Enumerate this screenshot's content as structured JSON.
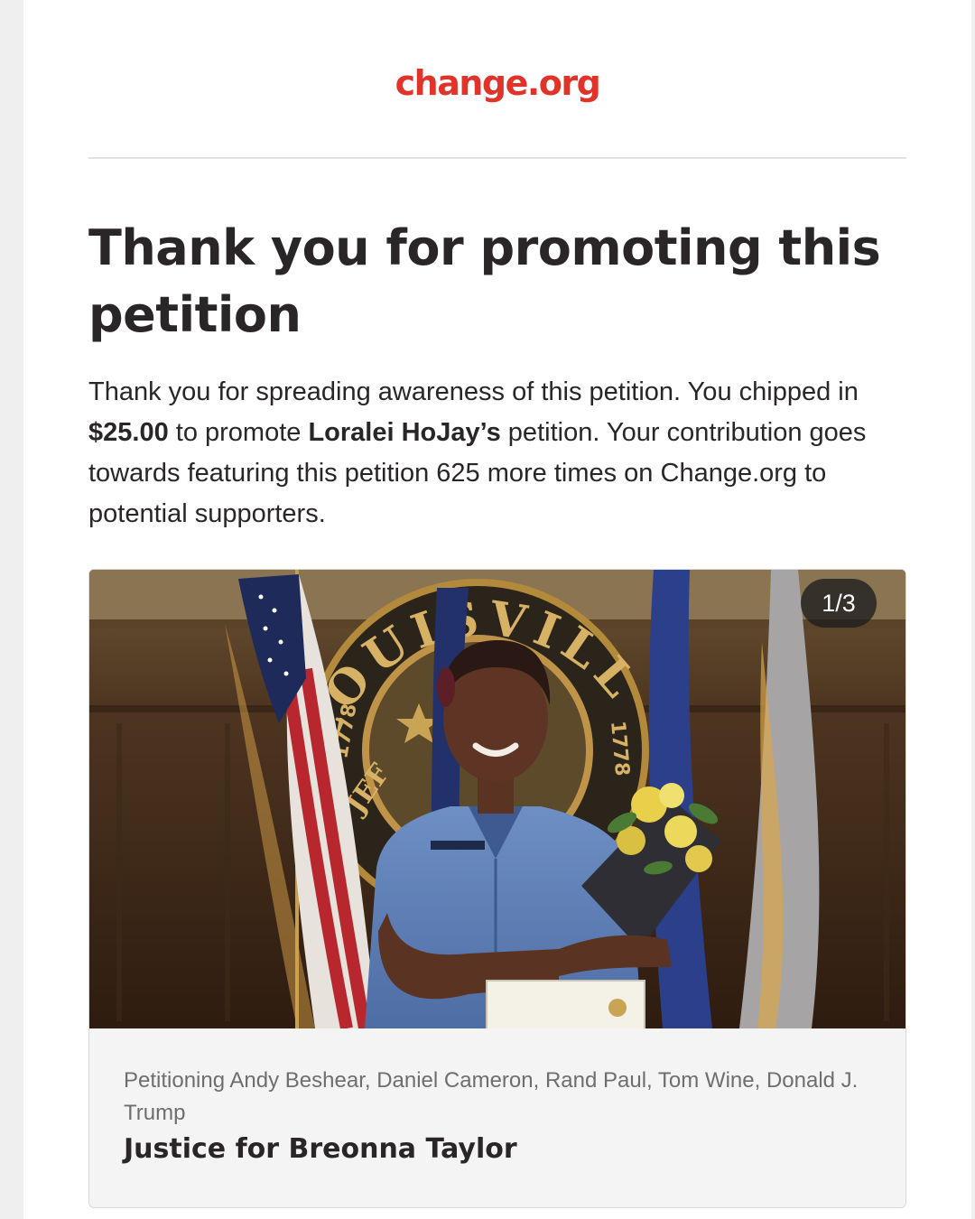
{
  "brand": {
    "logo_text": "change.org",
    "accent_color": "#e0332a"
  },
  "main": {
    "heading": "Thank you for promoting this petition",
    "message": {
      "intro": "Thank you for spreading awareness of this petition. You chipped in ",
      "amount": "$25.00",
      "mid": " to promote ",
      "starter": "Loralei HoJay’s",
      "outro": " petition. Your contribution goes towards featuring this petition 625 more times on Change.org to potential supporters."
    }
  },
  "petition_card": {
    "image": {
      "alt": "Woman in blue uniform holding flowers and a certificate in front of flags and the Louisville seal",
      "seal_text": "LOUISVILLE",
      "seal_year_left": "1778",
      "seal_year_right": "1778",
      "seal_partial": "JEF"
    },
    "image_counter": "1/3",
    "targets": "Petitioning Andy Beshear, Daniel Cameron, Rand Paul, Tom Wine, Donald J. Trump",
    "title": "Justice for Breonna Taylor"
  }
}
